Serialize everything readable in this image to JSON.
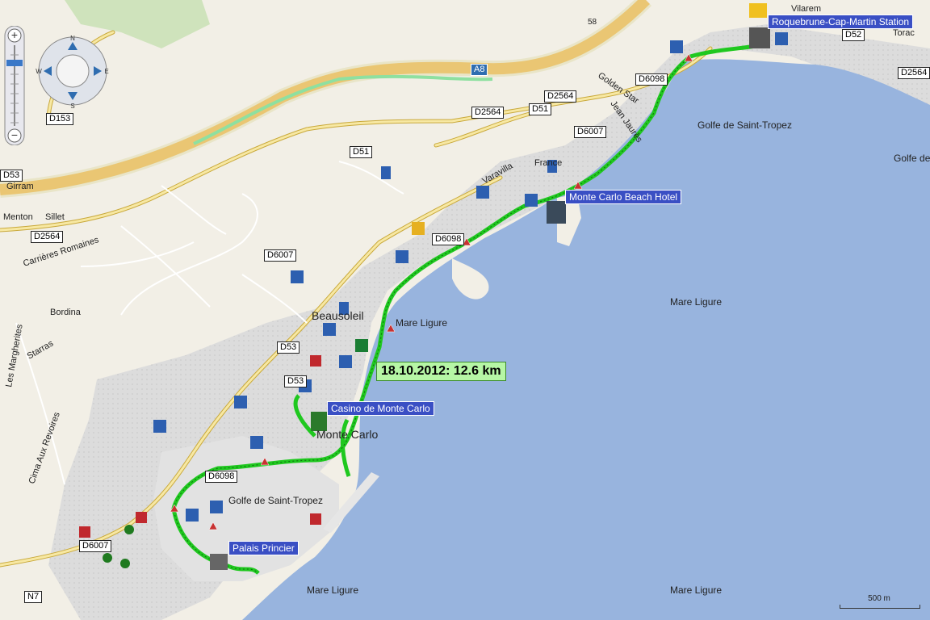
{
  "track": {
    "label": "18.10.2012: 12.6 km",
    "color": "#1fc81f"
  },
  "poi_labels": [
    {
      "id": "station",
      "text": "Roquebrune-Cap-Martin Station"
    },
    {
      "id": "beach_hotel",
      "text": "Monte Carlo Beach Hotel"
    },
    {
      "id": "casino",
      "text": "Casino de Monte Carlo"
    },
    {
      "id": "palais",
      "text": "Palais Princier"
    }
  ],
  "road_badges": [
    "A8",
    "D153",
    "D53",
    "D2564",
    "D2564",
    "D51",
    "D2564",
    "D6007",
    "D51",
    "D6098",
    "D6098",
    "D6007",
    "D53",
    "D53",
    "D6098",
    "D6007",
    "N7",
    "D52",
    "D2564"
  ],
  "place_labels": {
    "golfe1": "Golfe de Saint-Tropez",
    "golfe2": "Golfe de S",
    "golfe3": "Golfe de Saint-Tropez",
    "mare1": "Mare Ligure",
    "mare2": "Mare Ligure",
    "mare3": "Mare Ligure",
    "mare4": "Mare Ligure",
    "beausoleil": "Beausoleil",
    "montecarlo": "Monte Carlo",
    "france": "France",
    "bordina": "Bordina",
    "girram": "Girram",
    "sillet": "Sillet",
    "menton": "Menton",
    "carrieres": "Carrières Romaines",
    "margherites": "Les Margherites",
    "starras": "Starras",
    "cima": "Cima Aux Revoires",
    "varavilla": "Varavilla",
    "golden": "Golden Star",
    "jean": "Jean Jaurès",
    "villaremi": "Vilarem",
    "torac": "Torac",
    "num58": "58"
  },
  "scale": {
    "label": "500 m"
  },
  "colors": {
    "sea": "#98b4de",
    "land": "#f2efe6",
    "urban": "#d9d9d9",
    "road": "#f7e8a3",
    "road_edge": "#c9a93c",
    "motorway": "#f4b03c",
    "track": "#1fc81f",
    "park": "#cfe3bc"
  },
  "controls": {
    "icons": [
      "zoom-in-icon",
      "zoom-out-icon",
      "pan-north-icon",
      "pan-south-icon",
      "pan-east-icon",
      "pan-west-icon"
    ]
  }
}
